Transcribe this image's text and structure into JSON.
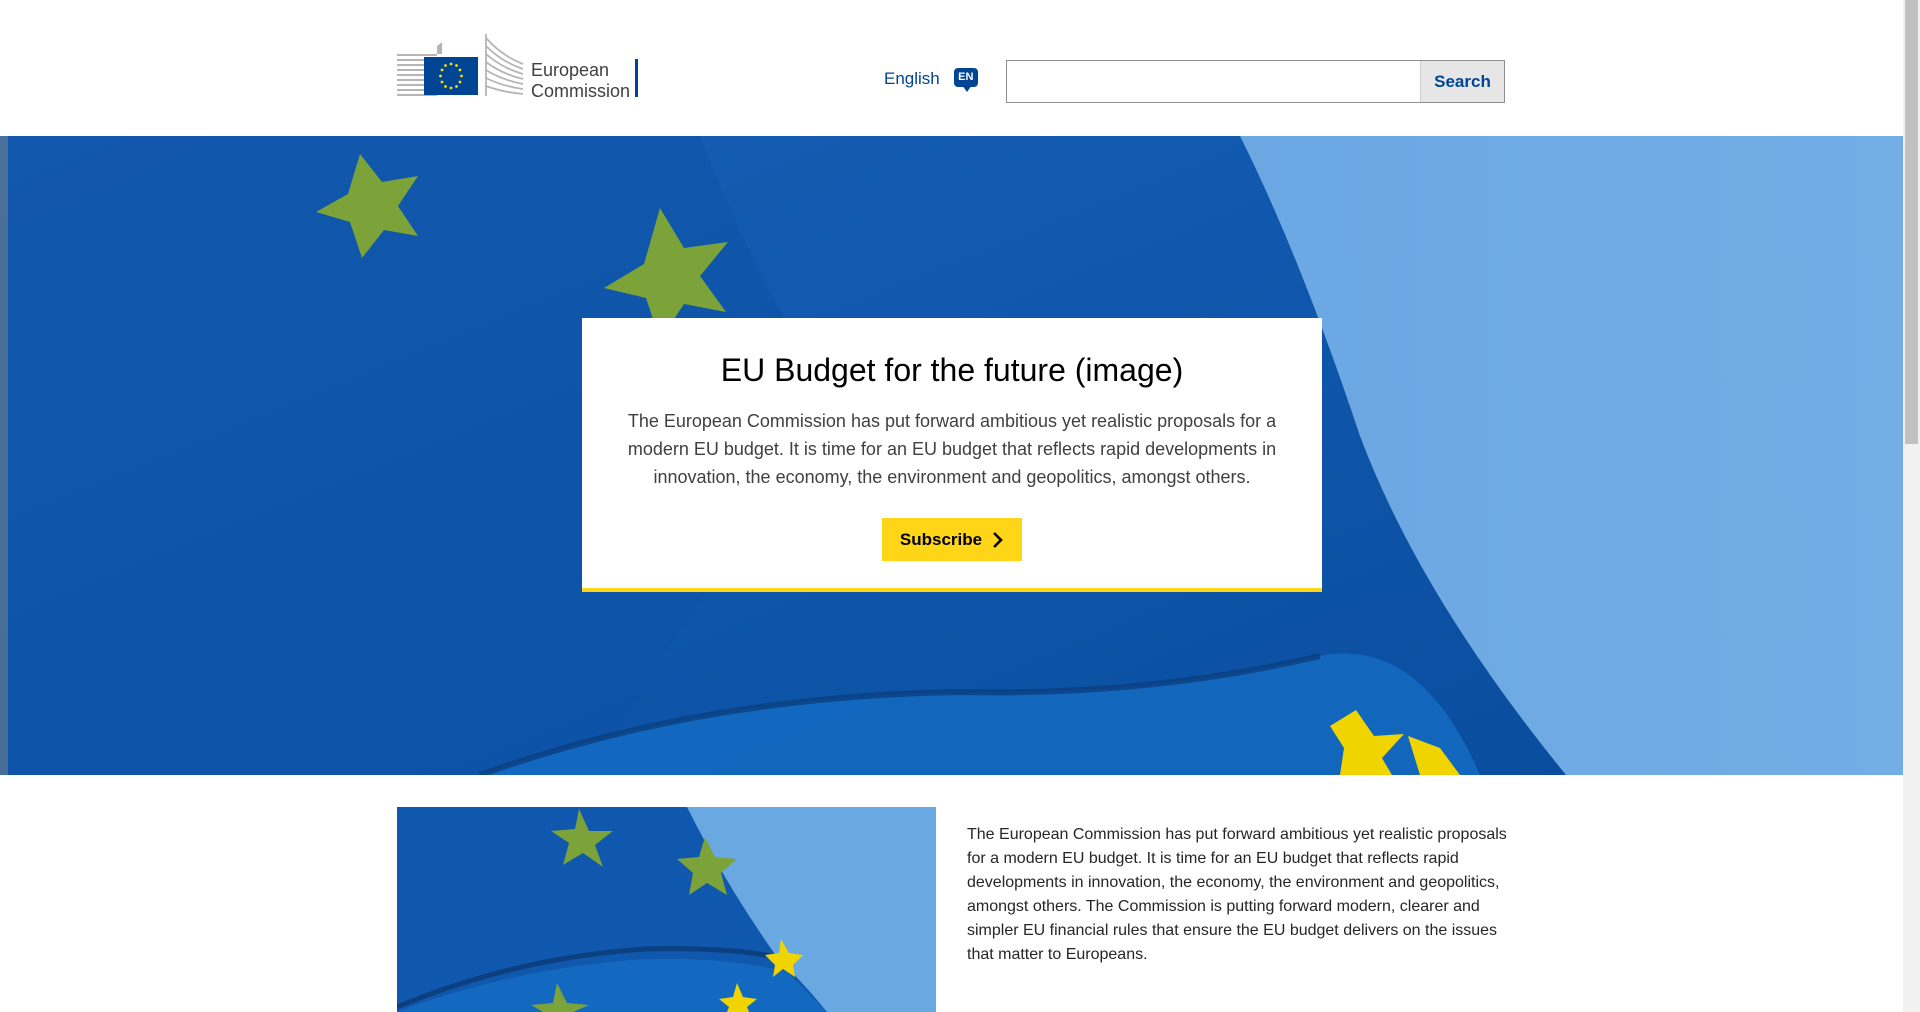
{
  "header": {
    "logo_line1": "European",
    "logo_line2": "Commission",
    "language_label": "English",
    "language_code": "EN",
    "search_placeholder": "",
    "search_button_label": "Search"
  },
  "hero": {
    "title": "EU Budget for the future (image)",
    "description": "The European Commission has put forward ambitious yet realistic proposals for a modern EU budget. It is time for an EU budget that reflects rapid developments in innovation, the economy, the environment and geopolitics, amongst others.",
    "subscribe_label": "Subscribe"
  },
  "content": {
    "paragraph": "The European Commission has put forward ambitious yet realistic proposals for a modern EU budget. It is time for an EU budget that reflects rapid developments in innovation, the economy, the environment and geopolitics, amongst others. The Commission is putting forward modern, clearer and simpler EU financial rules that ensure the EU budget delivers on the issues that matter to Europeans."
  },
  "colors": {
    "ec_blue": "#004494",
    "accent_yellow": "#ffd617",
    "flag_blue": "#0f5fb0",
    "sky_blue": "#6aa8e2",
    "star_green": "#7ba33a"
  }
}
